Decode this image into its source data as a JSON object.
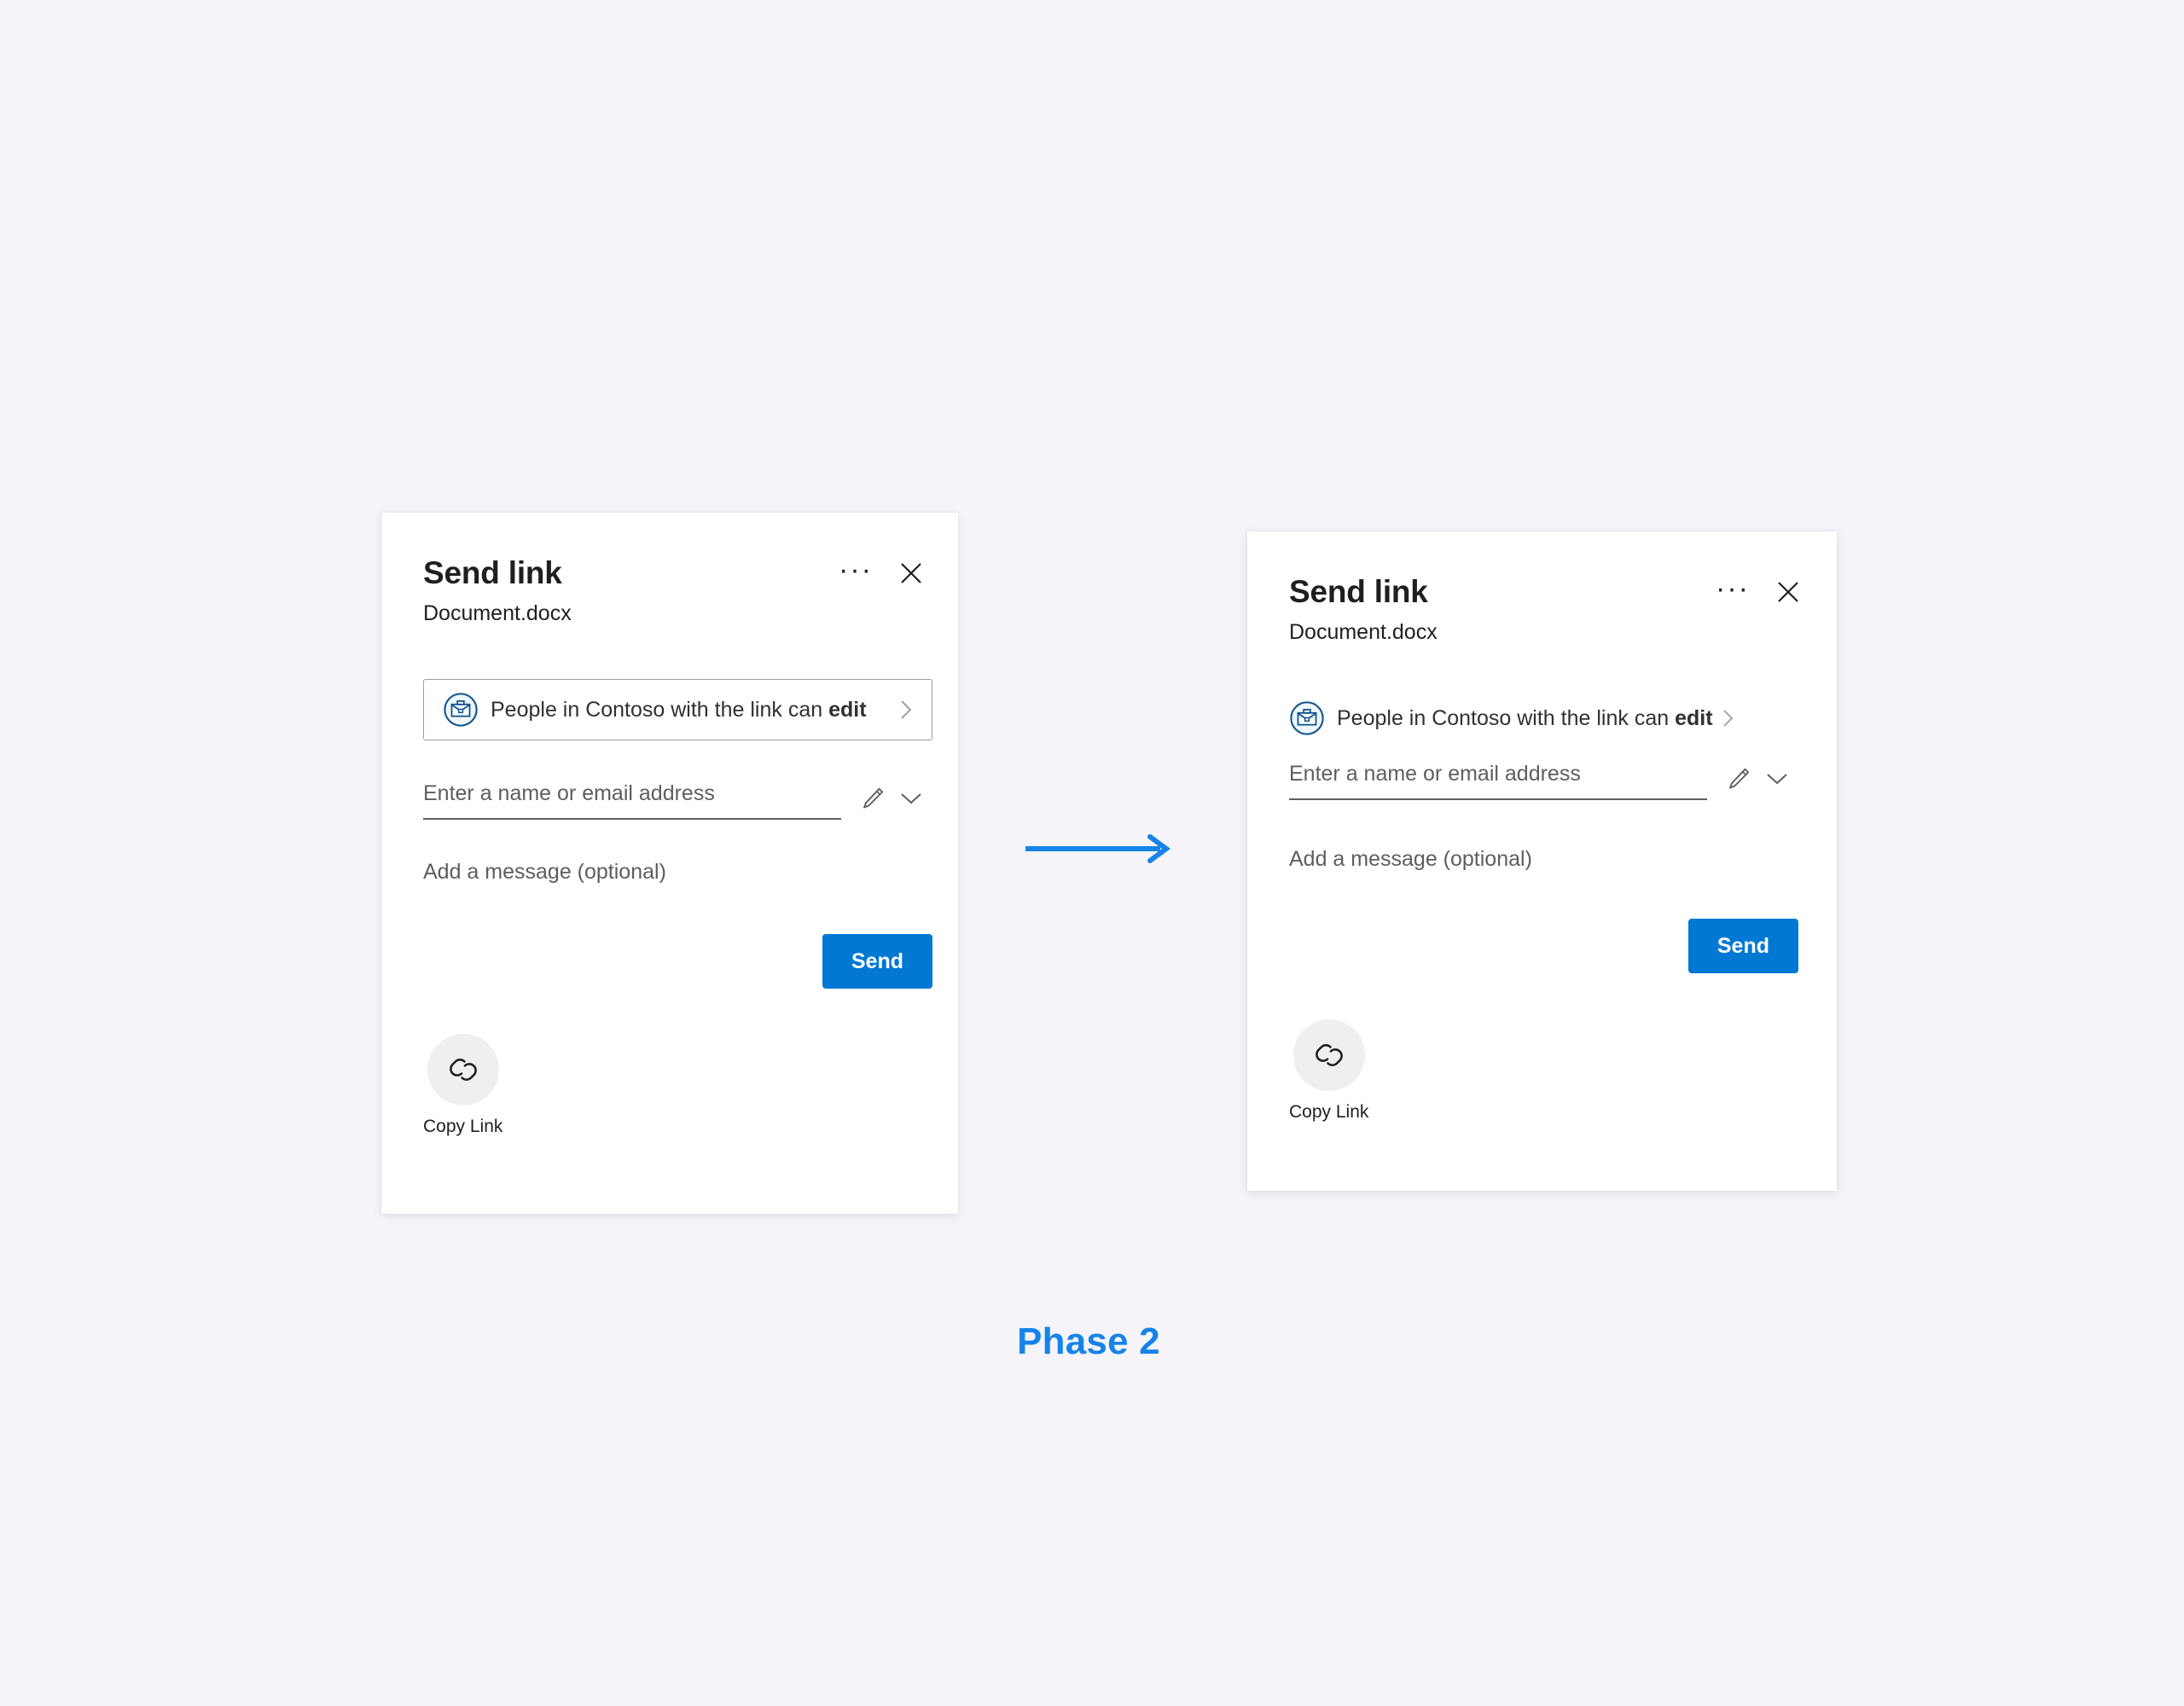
{
  "page": {
    "background_color": "#F5F4F9",
    "accent_color": "#0078D4",
    "caption": "Phase 2"
  },
  "arrow": {
    "name": "flow-arrow",
    "color": "#1683E8",
    "direction": "right"
  },
  "cards": [
    {
      "id": "before",
      "title": "Send link",
      "subtitle": "Document.docx",
      "overflow_label": "···",
      "close_label": "✕",
      "permission": {
        "icon": "briefcase-icon",
        "text_prefix": "People in Contoso with the link can ",
        "text_emphasis": "edit",
        "chevron": "chevron-right-icon",
        "boxed": true
      },
      "recipient": {
        "placeholder": "Enter a name or email address",
        "value": "",
        "pencil_icon": "pencil-icon",
        "chevron_icon": "chevron-down-icon"
      },
      "message_label": "Add a message (optional)",
      "send_label": "Send",
      "copy_link": {
        "icon": "link-chain-icon",
        "label": "Copy Link"
      }
    },
    {
      "id": "after",
      "title": "Send link",
      "subtitle": "Document.docx",
      "overflow_label": "···",
      "close_label": "✕",
      "permission": {
        "icon": "briefcase-icon",
        "text_prefix": "People in Contoso with the link can ",
        "text_emphasis": "edit",
        "chevron": "chevron-right-icon",
        "boxed": false
      },
      "recipient": {
        "placeholder": "Enter a name or email address",
        "value": "",
        "pencil_icon": "pencil-icon",
        "chevron_icon": "chevron-down-icon"
      },
      "message_label": "Add a message (optional)",
      "send_label": "Send",
      "copy_link": {
        "icon": "link-chain-icon",
        "label": "Copy Link"
      }
    }
  ]
}
